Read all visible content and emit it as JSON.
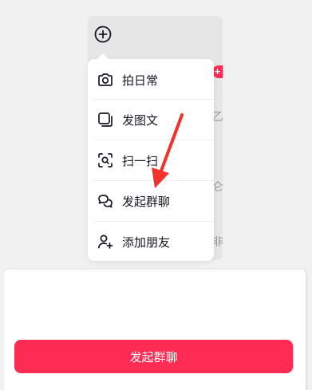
{
  "background": {
    "badge_text": "+",
    "peek_chars": [
      "乙",
      "仑",
      "非"
    ]
  },
  "menu": {
    "items": [
      {
        "label": "拍日常",
        "icon": "camera-icon"
      },
      {
        "label": "发图文",
        "icon": "image-text-icon"
      },
      {
        "label": "扫一扫",
        "icon": "scan-icon"
      },
      {
        "label": "发起群聊",
        "icon": "group-chat-icon"
      },
      {
        "label": "添加朋友",
        "icon": "add-friend-icon"
      }
    ]
  },
  "sheet": {
    "primary_button_label": "发起群聊"
  },
  "colors": {
    "accent": "#fe2c55",
    "text": "#161823",
    "background": "#f1f1f1"
  }
}
